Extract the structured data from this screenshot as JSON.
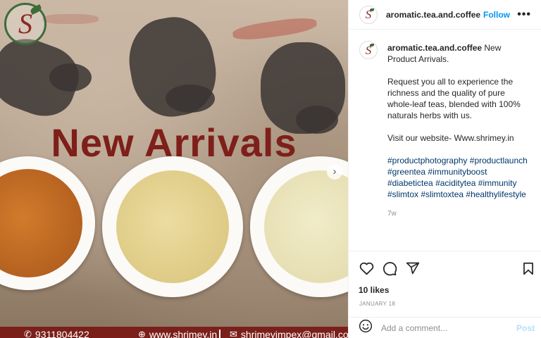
{
  "media": {
    "headline": "New Arrivals",
    "brand_logo_letter": "S",
    "footer": {
      "phone": "9311804422",
      "website": "www.shrimey.in",
      "email": "shrimeyimpex@gmail.com"
    },
    "colors": {
      "headline": "#7e1f1a",
      "band": "#7a1f1a",
      "logo_green": "#3e6b3a"
    }
  },
  "header": {
    "username": "aromatic.tea.and.coffee",
    "follow_label": "Follow",
    "more_label": "•••"
  },
  "caption": {
    "username": "aromatic.tea.and.coffee",
    "first_line": " New Product Arrivals.",
    "paragraph": "Request you all to experience the richness and the quality of pure whole-leaf teas, blended with 100% naturals herbs with us.",
    "website_line": "Visit our website- Www.shrimey.in",
    "hashtags": [
      "#productphotography",
      "#productlaunch",
      "#greentea",
      "#immunityboost",
      "#diabetictea",
      "#aciditytea",
      "#immunity",
      "#slimtox",
      "#slimtoxtea",
      "#healthylifestyle"
    ],
    "time_ago": "7w"
  },
  "actions": {
    "icons": [
      "heart-icon",
      "comment-icon",
      "share-icon",
      "bookmark-icon"
    ],
    "likes": "10 likes",
    "date": "JANUARY 18"
  },
  "comment": {
    "placeholder": "Add a comment...",
    "post_label": "Post"
  },
  "colors": {
    "link": "#00376b",
    "follow": "#0095f6",
    "muted": "#8e8e8e"
  }
}
